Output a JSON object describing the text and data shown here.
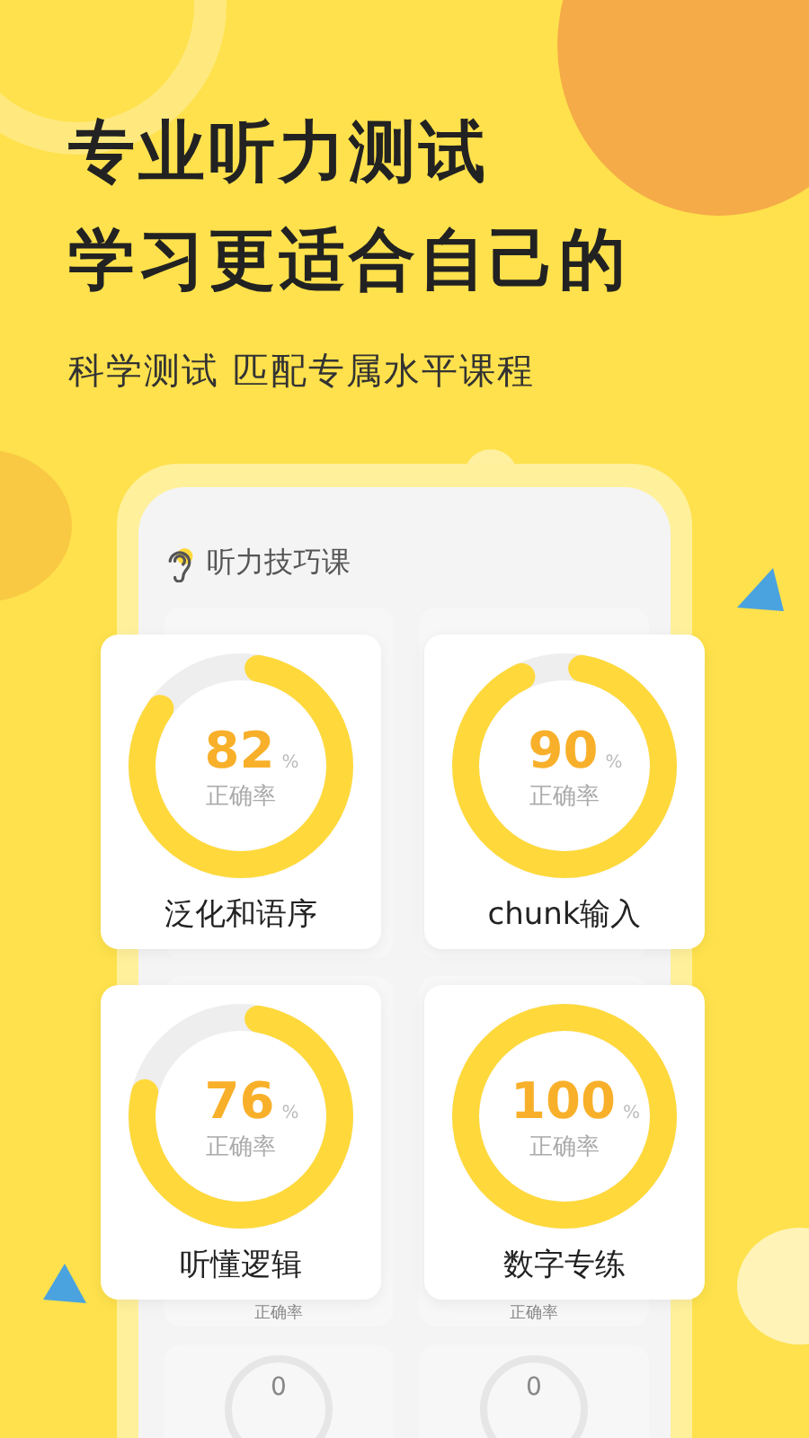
{
  "headline": [
    "专业听力测试",
    "学习更适合自己的"
  ],
  "subtitle": "科学测试 匹配专属水平课程",
  "phone": {
    "title": "听力技巧课",
    "peek_captions": [
      "正确率",
      "正确率"
    ],
    "bottom_values": [
      "0",
      "0"
    ]
  },
  "cards": [
    {
      "value": "82",
      "unit": "%",
      "caption": "正确率",
      "name": "泛化和语序",
      "level": 0.82
    },
    {
      "value": "90",
      "unit": "%",
      "caption": "正确率",
      "name": "chunk输入",
      "level": 0.9
    },
    {
      "value": "76",
      "unit": "%",
      "caption": "正确率",
      "name": "听懂逻辑",
      "level": 0.76
    },
    {
      "value": "100",
      "unit": "%",
      "caption": "正确率",
      "name": "数字专练",
      "level": 1
    }
  ]
}
